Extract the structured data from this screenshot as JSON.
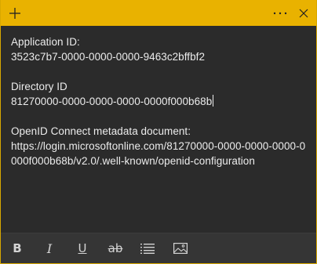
{
  "app": {
    "accent_color": "#e9b200",
    "background_color": "#2b2b2b"
  },
  "titlebar": {
    "add_icon": "plus-icon",
    "more_icon": "ellipsis-icon",
    "close_icon": "close-icon"
  },
  "note": {
    "app_id_label": "Application ID:",
    "app_id_value": "3523c7b7-0000-0000-0000-9463c2bffbf2",
    "dir_id_label": "Directory ID",
    "dir_id_value": "81270000-0000-0000-0000-0000f000b68b",
    "openid_label": "OpenID Connect metadata document:",
    "openid_value": "https://login.microsoftonline.com/81270000-0000-0000-0000-0000f000b68b/v2.0/.well-known/openid-configuration"
  },
  "toolbar": {
    "bold_label": "B",
    "italic_label": "I",
    "underline_label": "U",
    "strike_label": "ab",
    "list_icon": "bullet-list-icon",
    "image_icon": "image-icon"
  }
}
